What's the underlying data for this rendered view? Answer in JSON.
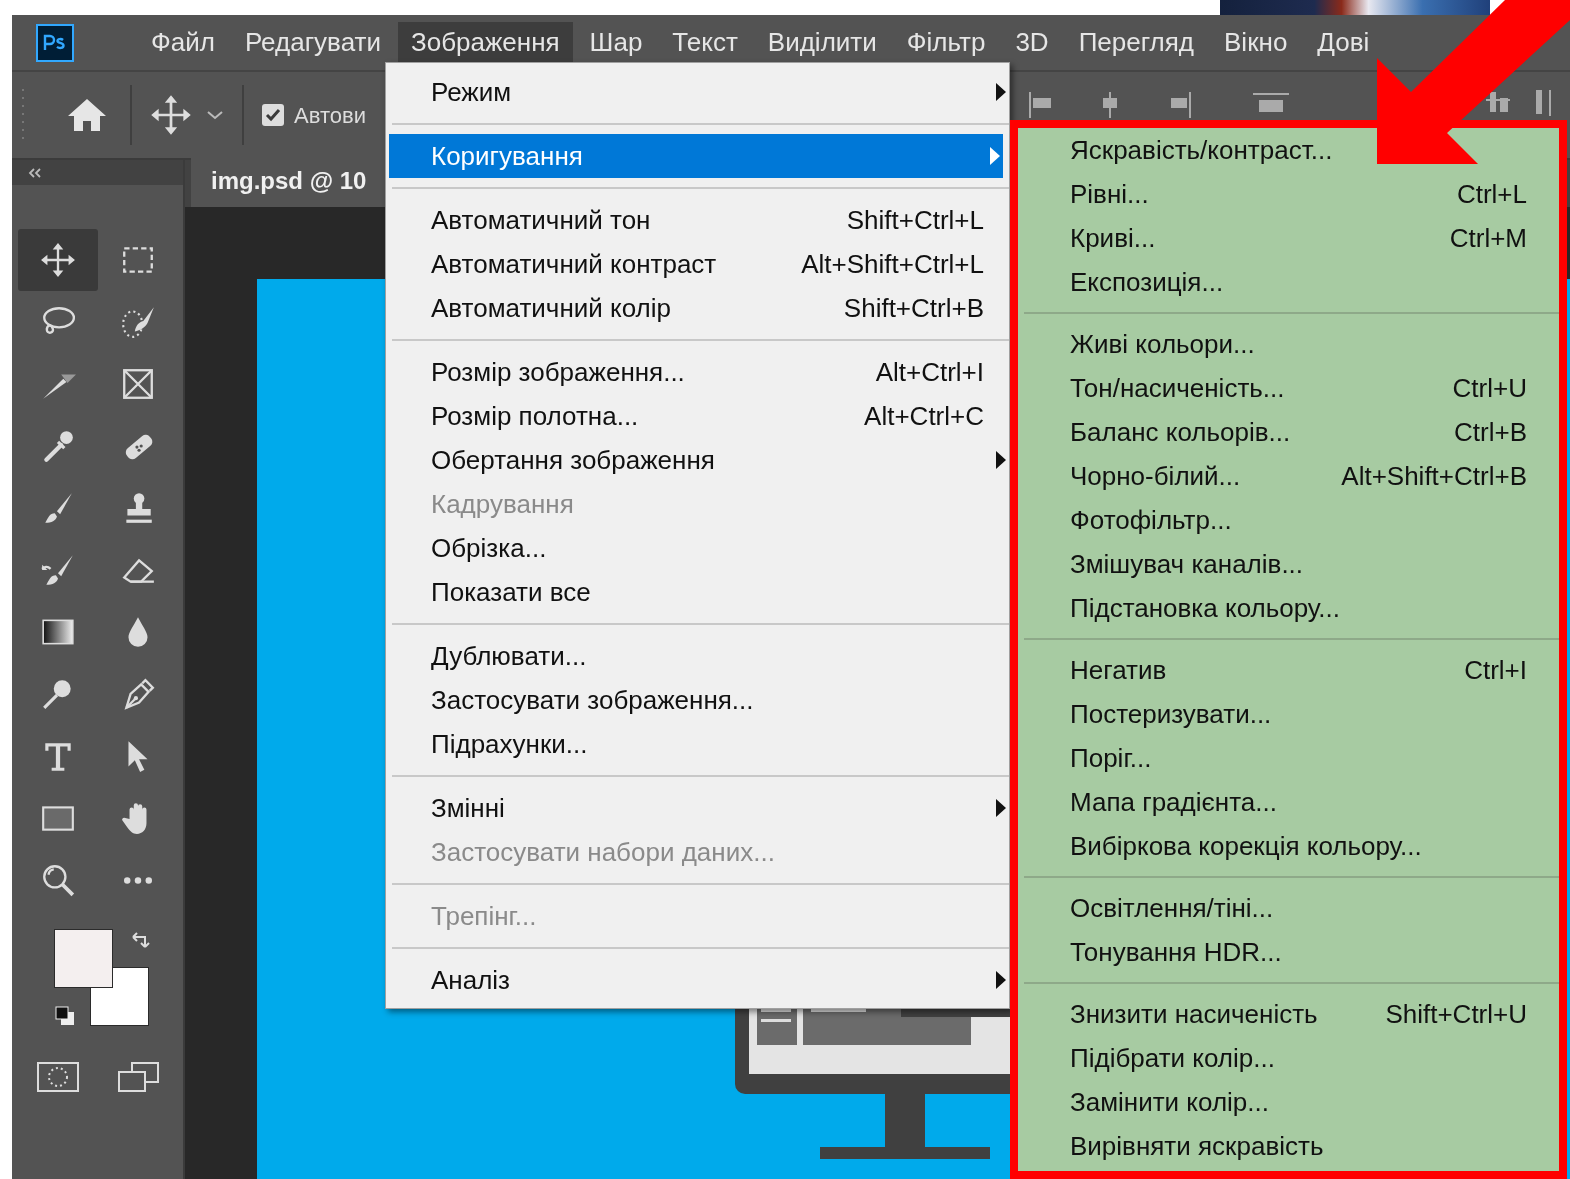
{
  "menubar": {
    "items": [
      {
        "label": "Файл",
        "selected": false
      },
      {
        "label": "Редагувати",
        "selected": false
      },
      {
        "label": "Зображення",
        "selected": true
      },
      {
        "label": "Шар",
        "selected": false
      },
      {
        "label": "Текст",
        "selected": false
      },
      {
        "label": "Виділити",
        "selected": false
      },
      {
        "label": "Фільтр",
        "selected": false
      },
      {
        "label": "3D",
        "selected": false
      },
      {
        "label": "Перегляд",
        "selected": false
      },
      {
        "label": "Вікно",
        "selected": false
      },
      {
        "label": "Дові",
        "selected": false
      }
    ]
  },
  "options_bar": {
    "auto_select": {
      "label": "Автови",
      "checked": true
    }
  },
  "tools": [
    {
      "kind": "move",
      "selected": true
    },
    {
      "kind": "marquee",
      "selected": false
    },
    {
      "kind": "lasso",
      "selected": false
    },
    {
      "kind": "quickselect",
      "selected": false
    },
    {
      "kind": "knife",
      "selected": false
    },
    {
      "kind": "frame",
      "selected": false
    },
    {
      "kind": "eyedropper",
      "selected": false
    },
    {
      "kind": "bandage",
      "selected": false
    },
    {
      "kind": "brush",
      "selected": false
    },
    {
      "kind": "stamp",
      "selected": false
    },
    {
      "kind": "historybrush",
      "selected": false
    },
    {
      "kind": "eraser",
      "selected": false
    },
    {
      "kind": "gradient",
      "selected": false
    },
    {
      "kind": "drop",
      "selected": false
    },
    {
      "kind": "dodge",
      "selected": false
    },
    {
      "kind": "pen",
      "selected": false
    },
    {
      "kind": "type",
      "selected": false
    },
    {
      "kind": "pointer",
      "selected": false
    },
    {
      "kind": "rectangle",
      "selected": false
    },
    {
      "kind": "hand",
      "selected": false
    },
    {
      "kind": "zoom",
      "selected": false
    },
    {
      "kind": "more",
      "selected": false
    }
  ],
  "document_tab": {
    "title": "img.psd @ 10"
  },
  "image_menu": {
    "groups": [
      [
        {
          "label": "Режим",
          "submenu": true,
          "selected": false,
          "disabled": false
        }
      ],
      [
        {
          "label": "Коригування",
          "submenu": true,
          "selected": true,
          "disabled": false
        }
      ],
      [
        {
          "label": "Автоматичний тон",
          "shortcut": "Shift+Ctrl+L",
          "submenu": false,
          "selected": false,
          "disabled": false
        },
        {
          "label": "Автоматичний контраст",
          "shortcut": "Alt+Shift+Ctrl+L",
          "submenu": false,
          "selected": false,
          "disabled": false
        },
        {
          "label": "Автоматичний колір",
          "shortcut": "Shift+Ctrl+B",
          "submenu": false,
          "selected": false,
          "disabled": false
        }
      ],
      [
        {
          "label": "Розмір зображення...",
          "shortcut": "Alt+Ctrl+I",
          "submenu": false,
          "selected": false,
          "disabled": false
        },
        {
          "label": "Розмір полотна...",
          "shortcut": "Alt+Ctrl+C",
          "submenu": false,
          "selected": false,
          "disabled": false
        },
        {
          "label": "Обертання зображення",
          "submenu": true,
          "selected": false,
          "disabled": false
        },
        {
          "label": "Кадрування",
          "submenu": false,
          "selected": false,
          "disabled": true
        },
        {
          "label": "Обрізка...",
          "submenu": false,
          "selected": false,
          "disabled": false
        },
        {
          "label": "Показати все",
          "submenu": false,
          "selected": false,
          "disabled": false
        }
      ],
      [
        {
          "label": "Дублювати...",
          "submenu": false,
          "selected": false,
          "disabled": false
        },
        {
          "label": "Застосувати зображення...",
          "submenu": false,
          "selected": false,
          "disabled": false
        },
        {
          "label": "Підрахунки...",
          "submenu": false,
          "selected": false,
          "disabled": false
        }
      ],
      [
        {
          "label": "Змінні",
          "submenu": true,
          "selected": false,
          "disabled": false
        },
        {
          "label": "Застосувати набори даних...",
          "submenu": false,
          "selected": false,
          "disabled": true
        }
      ],
      [
        {
          "label": "Трепінг...",
          "submenu": false,
          "selected": false,
          "disabled": true
        }
      ],
      [
        {
          "label": "Аналіз",
          "submenu": true,
          "selected": false,
          "disabled": false
        }
      ]
    ]
  },
  "adjustments_menu": {
    "groups": [
      [
        {
          "label": "Яскравість/контраст..."
        },
        {
          "label": "Рівні...",
          "shortcut": "Ctrl+L"
        },
        {
          "label": "Криві...",
          "shortcut": "Ctrl+M"
        },
        {
          "label": "Експозиція..."
        }
      ],
      [
        {
          "label": "Живі кольори..."
        },
        {
          "label": "Тон/насиченість...",
          "shortcut": "Ctrl+U"
        },
        {
          "label": "Баланс кольорів...",
          "shortcut": "Ctrl+B"
        },
        {
          "label": "Чорно-білий...",
          "shortcut": "Alt+Shift+Ctrl+B"
        },
        {
          "label": "Фотофільтр..."
        },
        {
          "label": "Змішувач каналів..."
        },
        {
          "label": "Підстановка кольору..."
        }
      ],
      [
        {
          "label": "Негатив",
          "shortcut": "Ctrl+I"
        },
        {
          "label": "Постеризувати..."
        },
        {
          "label": "Поріг..."
        },
        {
          "label": "Мапа градієнта..."
        },
        {
          "label": "Вибіркова корекція кольору..."
        }
      ],
      [
        {
          "label": "Освітлення/тіні..."
        },
        {
          "label": "Тонування HDR..."
        }
      ],
      [
        {
          "label": "Знизити насиченість",
          "shortcut": "Shift+Ctrl+U"
        },
        {
          "label": "Підібрати колір..."
        },
        {
          "label": "Замінити колір..."
        },
        {
          "label": "Вирівняти яскравість"
        }
      ]
    ]
  }
}
